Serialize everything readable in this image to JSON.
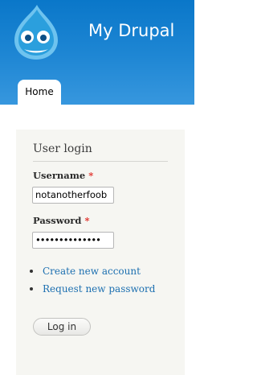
{
  "header": {
    "site_name": "My Drupal",
    "logo_icon": "drupal-drop-logo-icon"
  },
  "tabs": [
    {
      "label": "Home",
      "active": true
    }
  ],
  "login_block": {
    "title": "User login",
    "username": {
      "label": "Username",
      "required_marker": "*",
      "value": "notanotherfoob"
    },
    "password": {
      "label": "Password",
      "required_marker": "*",
      "masked_value": "••••••••••••••"
    },
    "links": [
      "Create new account",
      "Request new password"
    ],
    "submit_label": "Log in"
  },
  "colors": {
    "header_blue": "#1f87d4",
    "link_blue": "#1c6fb0",
    "required_red": "#e0302a",
    "block_background": "#f6f6f2"
  }
}
